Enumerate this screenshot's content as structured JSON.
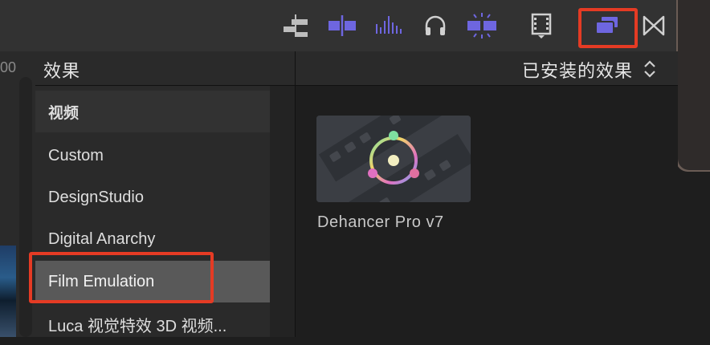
{
  "toolbar": {
    "icons": [
      "clip-connect-icon",
      "trim-icon",
      "waveform-icon",
      "headphones-icon",
      "skimming-icon",
      "film-browser-icon",
      "effects-browser-icon",
      "transitions-icon"
    ],
    "accent_color": "#6e66e0"
  },
  "left_strip": {
    "partial_text": "00"
  },
  "panel": {
    "title": "效果",
    "filter_label": "已安装的效果"
  },
  "sidebar": {
    "items": [
      {
        "label": "视频",
        "type": "header"
      },
      {
        "label": "Custom"
      },
      {
        "label": "DesignStudio"
      },
      {
        "label": "Digital Anarchy"
      },
      {
        "label": "Film Emulation",
        "selected": true
      },
      {
        "label": "Luca 视觉特效 3D 视频..."
      }
    ]
  },
  "effects": [
    {
      "name": "Dehancer Pro v7"
    }
  ]
}
